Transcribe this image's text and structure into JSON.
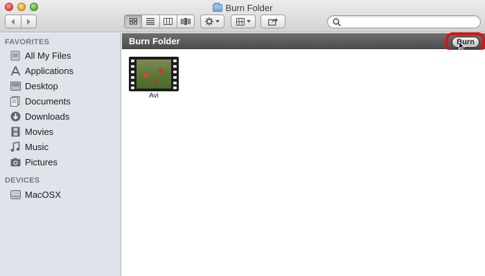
{
  "window": {
    "title": "Burn Folder"
  },
  "toolbar": {
    "back_icon": "chevron-left-icon",
    "forward_icon": "chevron-right-icon",
    "view_modes": [
      "icon-view",
      "list-view",
      "column-view",
      "cover-flow-view"
    ],
    "active_view": "icon-view",
    "action_icon": "gear-icon",
    "arrange_icon": "grid-icon",
    "share_icon": "share-icon"
  },
  "search": {
    "value": "",
    "placeholder": ""
  },
  "sidebar": {
    "favorites_heading": "FAVORITES",
    "favorites": [
      {
        "label": "All My Files",
        "icon": "all-files-icon"
      },
      {
        "label": "Applications",
        "icon": "applications-icon"
      },
      {
        "label": "Desktop",
        "icon": "desktop-icon"
      },
      {
        "label": "Documents",
        "icon": "documents-icon"
      },
      {
        "label": "Downloads",
        "icon": "downloads-icon"
      },
      {
        "label": "Movies",
        "icon": "movies-icon"
      },
      {
        "label": "Music",
        "icon": "music-icon"
      },
      {
        "label": "Pictures",
        "icon": "pictures-icon"
      }
    ],
    "devices_heading": "DEVICES",
    "devices": [
      {
        "label": "MacOSX",
        "icon": "disk-icon"
      }
    ]
  },
  "pathbar": {
    "title": "Burn Folder",
    "burn_label": "Burn"
  },
  "files": [
    {
      "name": "Avi",
      "icon": "video-file-icon"
    }
  ],
  "colors": {
    "highlight": "#e01010",
    "sidebar_bg": "#dee4ea",
    "pathbar_bg": "#5a5a5a"
  }
}
